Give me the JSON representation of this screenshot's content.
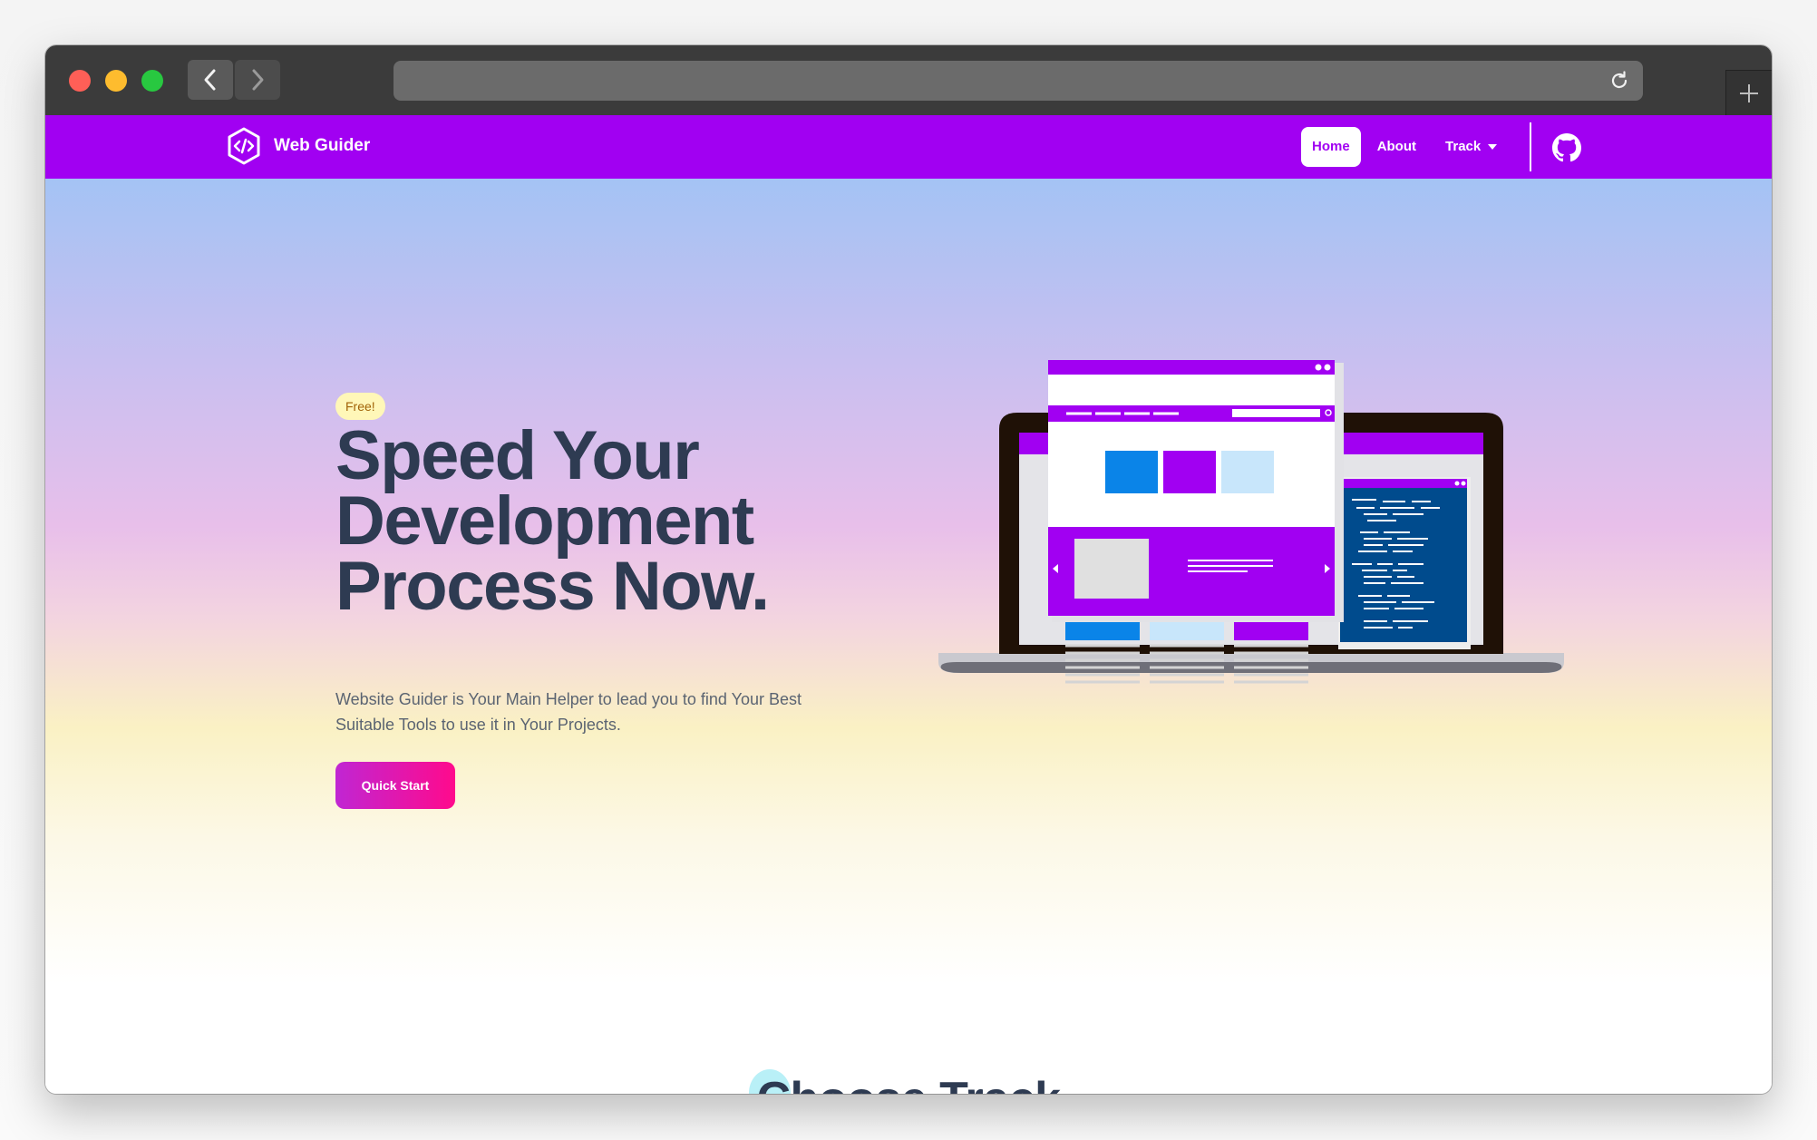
{
  "colors": {
    "brand": "#a100f2",
    "headline": "#2e3b52",
    "cta_start": "#c026d3",
    "cta_end": "#ff0a8c",
    "badge_bg": "#fff7b8"
  },
  "browser": {
    "back_icon": "chevron-left-icon",
    "forward_icon": "chevron-right-icon",
    "reload_icon": "reload-icon",
    "newtab_icon": "plus-icon"
  },
  "nav": {
    "brand": "Web Guider",
    "logo_icon": "code-hexagon-icon",
    "links": [
      {
        "label": "Home",
        "active": true
      },
      {
        "label": "About",
        "active": false
      },
      {
        "label": "Track",
        "active": false,
        "dropdown": true
      }
    ],
    "github_icon": "github-icon"
  },
  "hero": {
    "badge": "Free!",
    "headline_line1": "Speed Your",
    "headline_line2": "Development",
    "headline_line3": "Process Now.",
    "subtitle": "Website Guider is Your Main Helper to lead you to find Your Best Suitable Tools to use it in Your Projects.",
    "cta": "Quick Start",
    "illustration_icon": "laptop-webpage-illustration"
  },
  "tracks": {
    "title": "Choose Track"
  }
}
